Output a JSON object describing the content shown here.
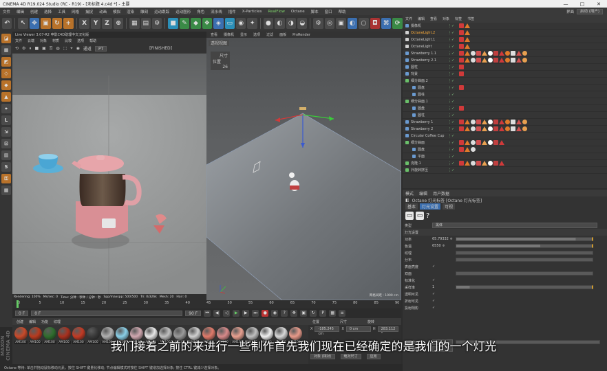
{
  "window": {
    "title": "CINEMA 4D R19.024 Studio (RC - R19) - [未标题 4.c4d *] - 主要",
    "minimize": "—",
    "maximize": "□",
    "close": "✕"
  },
  "menubar": {
    "items": [
      "文件",
      "编辑",
      "创建",
      "选择",
      "工具",
      "网格",
      "捕捉",
      "动画",
      "模拟",
      "渲染",
      "雕刻",
      "运动跟踪",
      "运动图形",
      "角色",
      "流水线",
      "插件",
      "X-Particles",
      "RealFlow",
      "Octane",
      "脚本",
      "窗口",
      "帮助"
    ],
    "highlight_item": "RealFlow",
    "layout_label": "界面",
    "layout_value": "启动 (用户)"
  },
  "toolbar": {
    "axis_x": "X",
    "axis_y": "Y",
    "axis_z": "Z"
  },
  "live_viewer": {
    "title": "Live Viewer 3.07-R2 申影C4D助理中文汉化版",
    "menu": [
      "文件",
      "云端",
      "对象",
      "材质",
      "比较",
      "选项",
      "帮助"
    ],
    "mode_label": "通道",
    "mode_value": "PT",
    "camera_label": "[FINISHED]",
    "status": [
      "Rendering: 100%",
      "Ms/sec: 0",
      "Time: 分钟 : 秒钟 / 分钟 : 秒",
      "Spp/maxspp: 500/500",
      "Tri: 0/326k",
      "Mesh: 20",
      "Hair: 0"
    ]
  },
  "viewport": {
    "menu": [
      "查看",
      "摄像机",
      "显示",
      "选项",
      "过滤",
      "面板",
      "ProRender"
    ],
    "label": "透视视图",
    "grid_info": "网格间距 : 1000 cm",
    "sub_label1": "尺寸",
    "sub_label2": "位置",
    "sub_label3": "26"
  },
  "object_manager": {
    "tabs": [
      "文件",
      "编辑",
      "查看",
      "对象",
      "标签",
      "书签"
    ],
    "objects": [
      {
        "name": "摄像机",
        "color": "#6a9ad0",
        "sel": false
      },
      {
        "name": "OctaneLight.2",
        "color": "#d0d0d0",
        "sel": true
      },
      {
        "name": "OctaneLight.1",
        "color": "#d0d0d0",
        "sel": false
      },
      {
        "name": "OctaneLight",
        "color": "#d0d0d0",
        "sel": false
      },
      {
        "name": "Strawberry 1.1",
        "color": "#6a9ad0",
        "sel": false
      },
      {
        "name": "Strawberry 2.1",
        "color": "#6a9ad0",
        "sel": false
      },
      {
        "name": "圆柱",
        "color": "#6a9ad0",
        "sel": false
      },
      {
        "name": "背景",
        "color": "#6a9ad0",
        "sel": false
      },
      {
        "name": "细分曲面.2",
        "color": "#6ac06a",
        "sel": false
      },
      {
        "name": "圆盘",
        "color": "#6a9ad0",
        "sel": false
      },
      {
        "name": "圆柱",
        "color": "#6a9ad0",
        "sel": false
      },
      {
        "name": "细分曲面.1",
        "color": "#6ac06a",
        "sel": false
      },
      {
        "name": "圆盘",
        "color": "#6a9ad0",
        "sel": false
      },
      {
        "name": "圆柱",
        "color": "#6a9ad0",
        "sel": false
      },
      {
        "name": "Strawberry 1",
        "color": "#6a9ad0",
        "sel": false
      },
      {
        "name": "Strawberry 2",
        "color": "#6a9ad0",
        "sel": false
      },
      {
        "name": "Circular Coffee Cup",
        "color": "#6a9ad0",
        "sel": false
      },
      {
        "name": "细分曲面",
        "color": "#6ac06a",
        "sel": false
      },
      {
        "name": "圆盘",
        "color": "#6a9ad0",
        "sel": false
      },
      {
        "name": "平面",
        "color": "#6a9ad0",
        "sel": false
      },
      {
        "name": "克隆.1",
        "color": "#6ac06a",
        "sel": false
      },
      {
        "name": "外旋转挤压",
        "color": "#6ac06a",
        "sel": false
      }
    ]
  },
  "attribute_manager": {
    "tabs": [
      "模式",
      "编辑",
      "用户数据"
    ],
    "object_title": "Octane 灯光标签 [Octane 灯光标签]",
    "subtabs": [
      "基本",
      "灯光设置",
      "可视"
    ],
    "active_subtab": "灯光设置",
    "light_type_label": "类型",
    "light_type_value": "黑体",
    "section": "灯光设置",
    "rows": [
      {
        "label": "功率",
        "value": "65.79332 ≑",
        "fill": 0.88
      },
      {
        "label": "色温",
        "value": "6550 ≑",
        "fill": 0.62
      },
      {
        "label": "纹理",
        "value": "",
        "fill": 0
      },
      {
        "label": "分布",
        "value": "",
        "fill": 0
      },
      {
        "label": "表面亮度",
        "value": "✓",
        "fill": 0
      },
      {
        "label": "双面",
        "value": "",
        "fill": 0
      },
      {
        "label": "标准化",
        "value": "✓",
        "fill": 0
      },
      {
        "label": "采样率",
        "value": "1",
        "fill": 0.1
      },
      {
        "label": "透明可见",
        "value": "✓",
        "fill": 0
      },
      {
        "label": "折射可见",
        "value": "✓",
        "fill": 0
      },
      {
        "label": "投射阴影",
        "value": "✓",
        "fill": 0
      }
    ],
    "opacity_label": "透明度",
    "opacity_value": "1",
    "id_label": "灯光通道ID",
    "id_value": "1"
  },
  "timeline": {
    "ticks": [
      "0",
      "5",
      "10",
      "15",
      "20",
      "25",
      "30",
      "35",
      "40",
      "45",
      "50",
      "55",
      "60",
      "65",
      "70",
      "75",
      "80",
      "85",
      "90"
    ],
    "frame_start": "0 F",
    "frame_end": "90 F",
    "current": "0 F"
  },
  "material_manager": {
    "menu": [
      "创建",
      "编辑",
      "功能",
      "纹理"
    ],
    "materials": [
      {
        "label": "AM100",
        "color": "#c94a2a"
      },
      {
        "label": "AM100",
        "color": "#b83a1e"
      },
      {
        "label": "AM100",
        "color": "#2f6d2d"
      },
      {
        "label": "AM100",
        "color": "#a8301e"
      },
      {
        "label": "AM100",
        "color": "#c23a24"
      },
      {
        "label": "AM100",
        "color": "#3a3a3a"
      },
      {
        "label": "AM100",
        "color": "#b0b0b0"
      },
      {
        "label": "AM100",
        "color": "#8ad0e8"
      },
      {
        "label": "AM100",
        "color": "#d0a8b0"
      },
      {
        "label": "AM100",
        "color": "#e8e8e8"
      },
      {
        "label": "AM100",
        "color": "#c0c0c0"
      },
      {
        "label": "AM100",
        "color": "#9a9a9a"
      },
      {
        "label": "AM100",
        "color": "#d0d0d0"
      },
      {
        "label": "AM100",
        "color": "#e07a6a"
      },
      {
        "label": "AM100",
        "color": "#d88a8a"
      },
      {
        "label": "AM100",
        "color": "#e8a090"
      },
      {
        "label": "AM100",
        "color": "#c0c0c0"
      },
      {
        "label": "AM100",
        "color": "#f0f0f0"
      },
      {
        "label": "AM100",
        "color": "#d8d8d8"
      },
      {
        "label": "AM100",
        "color": "#e89a8a"
      }
    ]
  },
  "coordinates": {
    "headers": [
      "位置",
      "尺寸",
      "旋转"
    ],
    "x_pos": "-185.245 cm",
    "x_size": "0 cm",
    "x_rot": "283.112 °",
    "mode1": "对象 (相对)",
    "mode2": "绝对尺寸",
    "apply": "应用"
  },
  "subtitle": "我们接着之前的来进行一些制作首先我们现在已经确定的是我们的一个灯光",
  "statusbar": "Octane    等待: 单击并拖动鼠标移动元素。按住 SHIFT 键量化移动; 节点编辑模式时按住 SHIFT 键增加选择对象; 按住 CTRL 键减少选择对象。",
  "branding": "MAXON CINEMA 4D"
}
